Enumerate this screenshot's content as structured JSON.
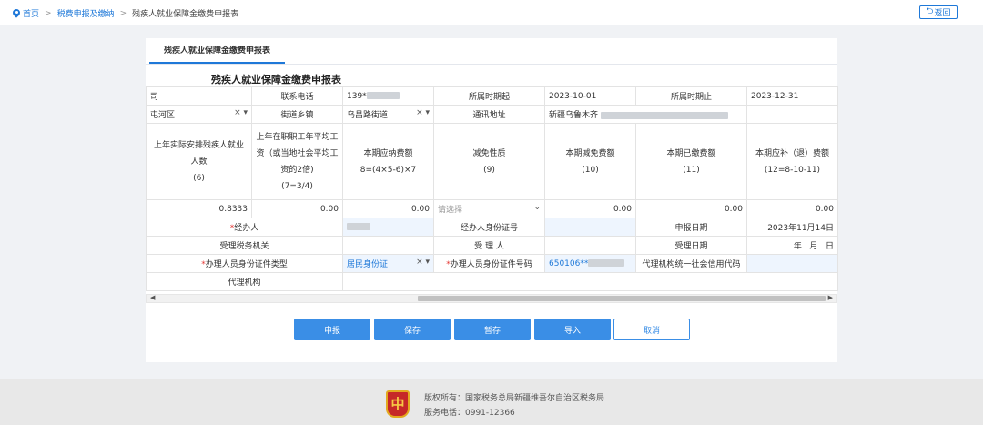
{
  "breadcrumb": {
    "home": "首页",
    "section": "税费申报及缴纳",
    "current": "残疾人就业保障金缴费申报表"
  },
  "back_label": "返回",
  "tab_label": "残疾人就业保障金缴费申报表",
  "form_title": "残疾人就业保障金缴费申报表",
  "row1": {
    "c0": "司",
    "l1": "联系电话",
    "phone": "139*",
    "l2": "所属时期起",
    "start": "2023-10-01",
    "l3": "所属时期止",
    "end": "2023-12-31"
  },
  "row2": {
    "district": "屯河区",
    "l1": "街道乡镇",
    "street": "乌昌路街道",
    "l2": "通讯地址",
    "address": "新疆乌鲁木齐"
  },
  "headers": {
    "h6": "上年实际安排残疾人就业人数\n(6)",
    "h7": "上年在职职工年平均工资（或当地社会平均工资的2倍)\n(7=3/4)",
    "h8": "本期应纳费额\n8=(4×5-6)×7",
    "h9": "减免性质\n(9)",
    "h10": "本期减免费额\n(10)",
    "h11": "本期已缴费额\n(11)",
    "h12": "本期应补（退）费额\n(12=8-10-11)"
  },
  "values": {
    "v6": "0.8333",
    "v7": "0.00",
    "v8": "0.00",
    "v9": "请选择",
    "v10": "0.00",
    "v11": "0.00",
    "v12": "0.00"
  },
  "agent": {
    "label": "经办人",
    "id_label": "经办人身份证号",
    "date_label": "申报日期",
    "date": "2023年11月14日"
  },
  "tax": {
    "label": "受理税务机关",
    "receiver_label": "受 理 人",
    "accept_date_label": "受理日期",
    "accept_date": "年   月   日"
  },
  "handler": {
    "type_label": "办理人员身份证件类型",
    "type_value": "居民身份证",
    "no_label": "办理人员身份证件号码",
    "no_value": "650106**",
    "credit_label": "代理机构统一社会信用代码"
  },
  "agency_label": "代理机构",
  "buttons": {
    "submit": "申报",
    "save": "保存",
    "draft": "暂存",
    "import": "导入",
    "cancel": "取消"
  },
  "footer": {
    "copyright": "版权所有：国家税务总局新疆维吾尔自治区税务局",
    "phone": "服务电话：0991-12366",
    "logo_char": "中"
  }
}
